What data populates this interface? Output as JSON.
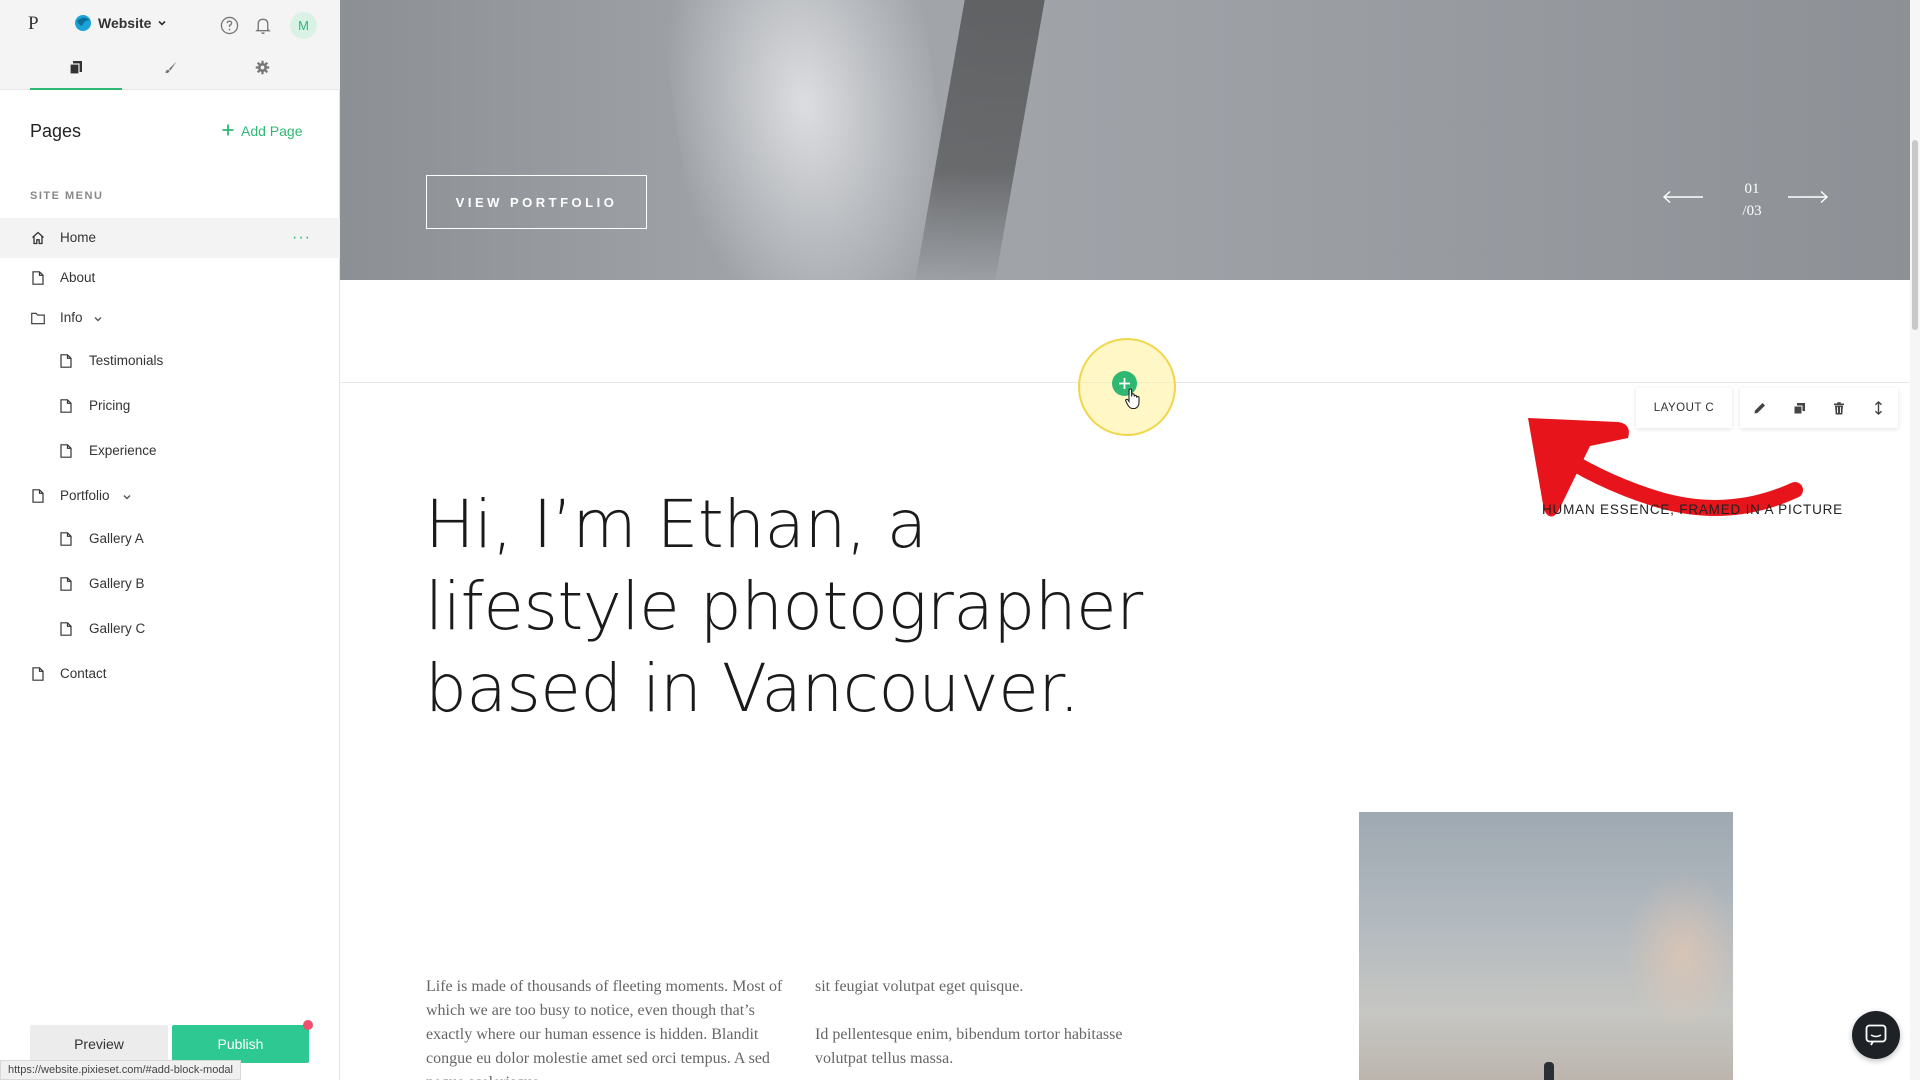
{
  "topbar": {
    "logo": "P",
    "site_name": "Website",
    "avatar_initial": "M",
    "icons": [
      "help-icon",
      "bell-icon"
    ]
  },
  "tabs": [
    {
      "name": "pages",
      "icon": "pages-icon",
      "active": true
    },
    {
      "name": "design",
      "icon": "brush-icon",
      "active": false
    },
    {
      "name": "settings",
      "icon": "gear-icon",
      "active": false
    }
  ],
  "pages_panel": {
    "title": "Pages",
    "add_page_label": "Add Page",
    "section_label": "SITE MENU",
    "items": [
      {
        "label": "Home",
        "icon": "home-icon",
        "active": true
      },
      {
        "label": "About",
        "icon": "page-icon"
      },
      {
        "label": "Info",
        "icon": "folder-icon",
        "expanded": true
      },
      {
        "label": "Testimonials",
        "icon": "page-icon",
        "child": true
      },
      {
        "label": "Pricing",
        "icon": "page-icon",
        "child": true
      },
      {
        "label": "Experience",
        "icon": "page-icon",
        "child": true
      },
      {
        "label": "Portfolio",
        "icon": "page-icon",
        "expanded": true
      },
      {
        "label": "Gallery A",
        "icon": "page-icon",
        "child": true
      },
      {
        "label": "Gallery B",
        "icon": "page-icon",
        "child": true
      },
      {
        "label": "Gallery C",
        "icon": "page-icon",
        "child": true
      },
      {
        "label": "Contact",
        "icon": "page-icon"
      }
    ],
    "more_label": "···"
  },
  "footer": {
    "preview_label": "Preview",
    "publish_label": "Publish",
    "status_url": "https://website.pixieset.com/#add-block-modal"
  },
  "hero": {
    "button_label": "VIEW PORTFOLIO",
    "slide_current": "01",
    "slide_total": "/03"
  },
  "block_toolbar": {
    "layout_label": "LAYOUT C",
    "tools": [
      "pencil-icon",
      "duplicate-icon",
      "trash-icon",
      "move-icon"
    ]
  },
  "content": {
    "headline": "Hi, I’m Ethan, a lifestyle photographer based in Vancouver.",
    "tagline": "HUMAN ESSENCE, FRAMED IN A PICTURE",
    "col1_p1": "Life is made of thousands of fleeting moments. Most of which we are too busy to notice, even though that’s exactly where our human essence is hidden. Blandit congue eu dolor molestie amet sed orci tempus. A sed neque scelerisque",
    "col2_p1": "sit feugiat volutpat eget quisque.",
    "col2_p2": "Id pellentesque enim, bibendum tortor habitasse volutpat tellus massa."
  },
  "colors": {
    "accent": "#2eb872",
    "publish": "#2ec892",
    "annotation_arrow": "#e8141b",
    "highlight": "#f1d64a"
  }
}
